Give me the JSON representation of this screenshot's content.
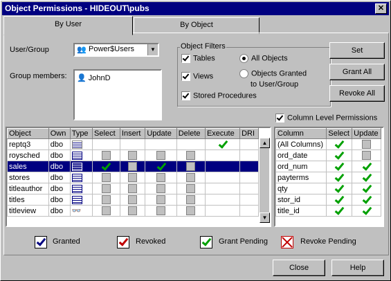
{
  "window": {
    "title": "Object Permissions - HIDEOUT\\pubs",
    "close_glyph": "✕"
  },
  "tabs": [
    {
      "label": "By User"
    },
    {
      "label": "By Object"
    }
  ],
  "user_group": {
    "label": "User/Group",
    "value": "Power$Users"
  },
  "group_members": {
    "label": "Group members:",
    "items": [
      "JohnD"
    ]
  },
  "object_filters": {
    "title": "Object Filters",
    "tables": {
      "label": "Tables",
      "checked": true
    },
    "views": {
      "label": "Views",
      "checked": true
    },
    "stored_procedures": {
      "label": "Stored Procedures",
      "checked": true
    },
    "all_objects": {
      "label": "All Objects",
      "selected": true
    },
    "objects_granted": {
      "label": "Objects Granted",
      "label2": "to User/Group",
      "selected": false
    }
  },
  "buttons": {
    "set": "Set",
    "grant_all": "Grant All",
    "revoke_all": "Revoke All",
    "close": "Close",
    "help": "Help"
  },
  "column_level": {
    "label": "Column Level Permissions",
    "checked": true
  },
  "objects_table": {
    "headers": [
      "Object",
      "Own",
      "Type",
      "Select",
      "Insert",
      "Update",
      "Delete",
      "Execute",
      "DRI"
    ],
    "rows": [
      {
        "object": "reptq3",
        "owner": "dbo",
        "type": "procedure",
        "execute": "grant_pending"
      },
      {
        "object": "roysched",
        "owner": "dbo",
        "type": "table"
      },
      {
        "object": "sales",
        "owner": "dbo",
        "type": "table",
        "selected": true,
        "select": "grant_pending",
        "update": "grant_pending"
      },
      {
        "object": "stores",
        "owner": "dbo",
        "type": "table"
      },
      {
        "object": "titleauthor",
        "owner": "dbo",
        "type": "table"
      },
      {
        "object": "titles",
        "owner": "dbo",
        "type": "table"
      },
      {
        "object": "titleview",
        "owner": "dbo",
        "type": "view"
      }
    ]
  },
  "columns_table": {
    "headers": [
      "Column",
      "Select",
      "Update"
    ],
    "rows": [
      {
        "name": "(All Columns)",
        "select": "grant_pending",
        "update": "none"
      },
      {
        "name": "ord_date",
        "select": "grant_pending",
        "update": "none"
      },
      {
        "name": "ord_num",
        "select": "grant_pending",
        "update": "grant_pending"
      },
      {
        "name": "payterms",
        "select": "grant_pending",
        "update": "grant_pending"
      },
      {
        "name": "qty",
        "select": "grant_pending",
        "update": "grant_pending"
      },
      {
        "name": "stor_id",
        "select": "grant_pending",
        "update": "grant_pending"
      },
      {
        "name": "title_id",
        "select": "grant_pending",
        "update": "grant_pending"
      }
    ]
  },
  "legend": {
    "granted": "Granted",
    "revoked": "Revoked",
    "grant_pending": "Grant Pending",
    "revoke_pending": "Revoke Pending"
  },
  "colors": {
    "titlebar": "#000080",
    "grant_pending": "#00a000",
    "revoked": "#c00000"
  }
}
